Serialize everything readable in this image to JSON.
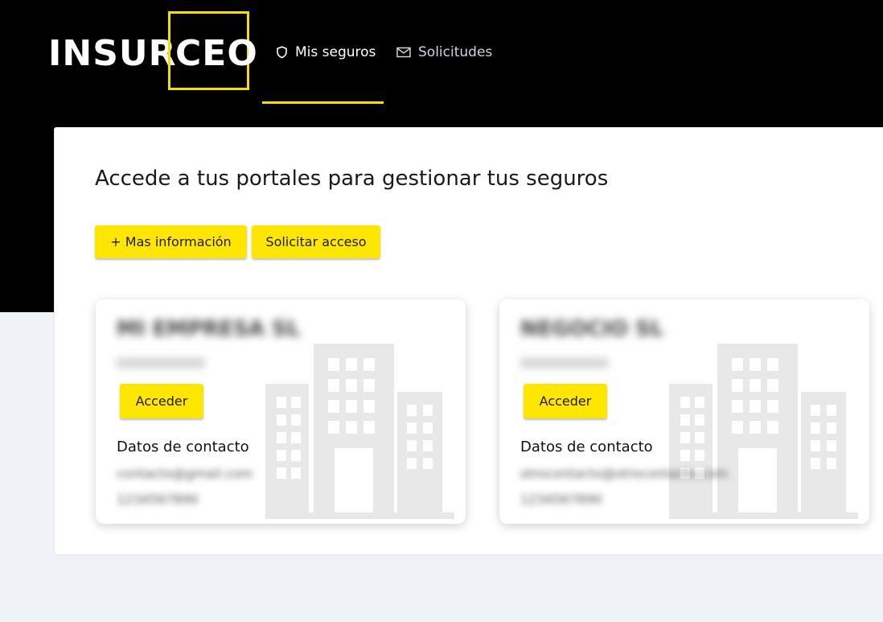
{
  "header": {
    "logo": {
      "part1": "INSUR",
      "part2": "CEO"
    },
    "nav": [
      {
        "label": "Mis seguros",
        "icon": "shield-icon",
        "active": true
      },
      {
        "label": "Solicitudes",
        "icon": "mail-icon",
        "active": false
      }
    ]
  },
  "main": {
    "title": "Accede a tus portales para gestionar tus seguros",
    "buttons": {
      "more_info": "+ Mas información",
      "request_access": "Solicitar acceso"
    },
    "cards": [
      {
        "name": "MI EMPRESA SL",
        "cif": "XXXXXXXXXX",
        "access_label": "Acceder",
        "contact_label": "Datos de contacto",
        "email": "contacto@gmail.com",
        "phone": "1234567890"
      },
      {
        "name": "NEGOCIO SL",
        "cif": "XXXXXXXXXX",
        "access_label": "Acceder",
        "contact_label": "Datos de contacto",
        "email": "otrocontacto@otrocontacto.com",
        "phone": "1234567890"
      }
    ]
  },
  "colors": {
    "accent": "#ffe600",
    "header_bg": "#000000",
    "page_bg": "#eff2f7"
  }
}
